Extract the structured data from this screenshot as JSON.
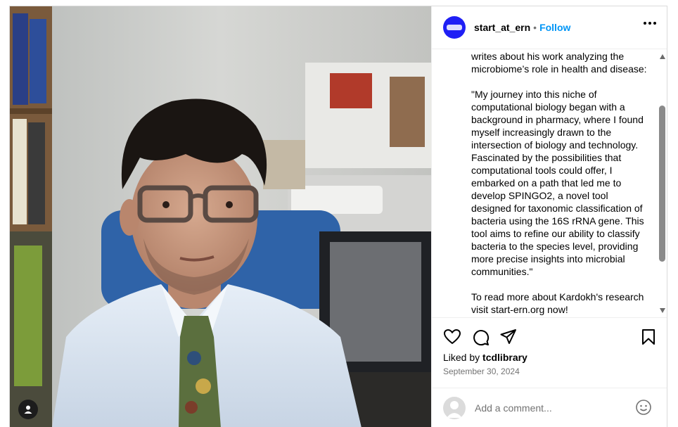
{
  "post": {
    "username": "start_at_ern",
    "separator": "•",
    "follow_label": "Follow",
    "caption_lines_1": [
      "writes about his work analyzing the",
      "microbiome’s role in health and disease:"
    ],
    "caption_lines_2": [
      "\"My journey into this niche of",
      "computational biology began with a",
      "background in pharmacy, where I found",
      "myself increasingly drawn to the",
      "intersection of biology and technology.",
      "Fascinated by the possibilities that",
      "computational tools could offer, I",
      "embarked on a path that led me to",
      "develop SPINGO2, a novel tool",
      "designed for taxonomic classification of",
      "bacteria using the 16S rRNA gene. This",
      "tool aims to refine our ability to classify",
      "bacteria to the species level, providing",
      "more precise insights into microbial",
      "communities.\""
    ],
    "caption_lines_3": [
      "To read more about Kardokh's research",
      "visit start-ern.org now!"
    ],
    "liked_prefix": "Liked by ",
    "liked_user": "tcdlibrary",
    "date": "September 30, 2024"
  },
  "comment": {
    "placeholder": "Add a comment..."
  },
  "icons": {
    "like": "heart-icon",
    "comment": "comment-bubble-icon",
    "share": "paper-plane-icon",
    "save": "bookmark-icon",
    "more": "more-options-icon",
    "emoji": "emoji-smiley-icon",
    "tagged": "user-tag-icon"
  },
  "colors": {
    "accent": "#0095f6",
    "avatar_brand": "#1f1ff5",
    "muted_text": "#737373"
  }
}
